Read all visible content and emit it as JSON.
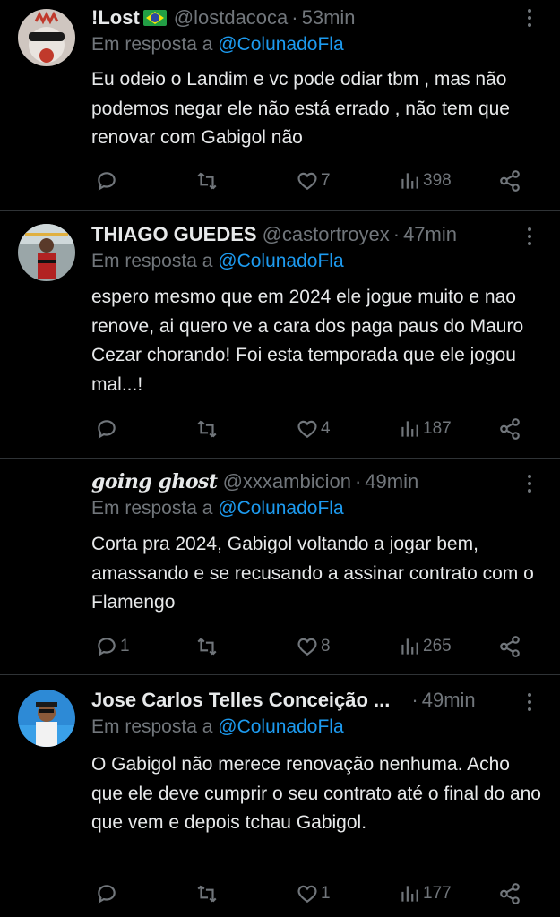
{
  "tweets": [
    {
      "name": "!Lost",
      "has_flag": true,
      "handle": "@lostdacoca",
      "sep": "·",
      "time": "53min",
      "reply_prefix": "Em resposta a",
      "reply_to": "@ColunadoFla",
      "text": "Eu odeio o Landim e vc pode odiar  tbm , mas não podemos negar ele não está errado , não tem que renovar com Gabigol não",
      "replies": "",
      "retweets": "",
      "likes": "7",
      "views": "398",
      "avatar_icon": "avatar-icon"
    },
    {
      "name": "THIAGO GUEDES",
      "handle": "@castortroyex",
      "sep": "·",
      "time": "47min",
      "reply_prefix": "Em resposta a",
      "reply_to": "@ColunadoFla",
      "text": "espero mesmo que em 2024 ele jogue muito e nao renove, ai quero ve a cara dos paga paus do Mauro Cezar chorando! Foi esta temporada que ele jogou mal...!",
      "replies": "",
      "retweets": "",
      "likes": "4",
      "views": "187",
      "avatar_icon": "avatar-icon"
    },
    {
      "name": "going ghost",
      "handle": "@xxxambicion",
      "sep": "·",
      "time": "49min",
      "reply_prefix": "Em resposta a",
      "reply_to": "@ColunadoFla",
      "text": "Corta pra 2024, Gabigol voltando a jogar bem, amassando e se recusando a assinar contrato com o Flamengo",
      "replies": "1",
      "retweets": "",
      "likes": "8",
      "views": "265",
      "avatar_icon": "avatar-icon"
    },
    {
      "name": "Jose Carlos Telles Conceição ...",
      "handle": "",
      "sep": "·",
      "time": "49min",
      "reply_prefix": "Em resposta a",
      "reply_to": "@ColunadoFla",
      "text": "O Gabigol não merece renovação nenhuma. Acho que ele deve cumprir o seu contrato até o final do ano que vem e depois tchau Gabigol.",
      "replies": "",
      "retweets": "",
      "likes": "1",
      "views": "177",
      "avatar_icon": "avatar-icon"
    }
  ],
  "icons": {
    "reply": "reply-icon",
    "retweet": "retweet-icon",
    "like": "heart-icon",
    "views": "views-icon",
    "share": "share-icon",
    "more": "more-icon",
    "flag": "brazil-flag-icon"
  },
  "colors": {
    "background": "#000000",
    "text": "#e7e9ea",
    "muted": "#71767b",
    "mention": "#1d9bf0",
    "divider": "#2f3336"
  }
}
